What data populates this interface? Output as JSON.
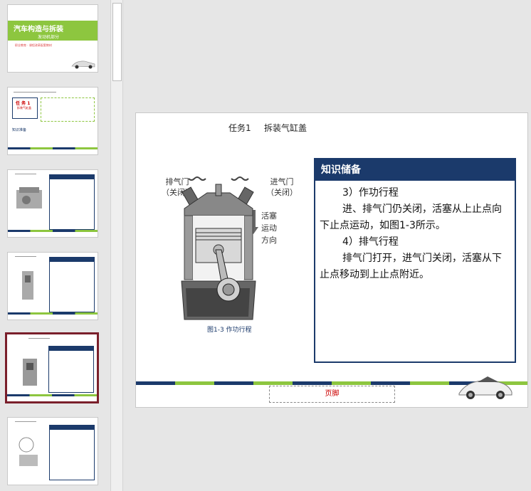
{
  "thumbnails": [
    {
      "index": 1,
      "title": "汽车构造与拆装",
      "subtitle": "发动机部分",
      "note": "职业教育 · 课程改革配套教材"
    },
    {
      "index": 2,
      "task_badge": "任 务",
      "task_num": "1",
      "sub": "知识准备",
      "caption": "拆装气缸盖"
    },
    {
      "index": 3
    },
    {
      "index": 4
    },
    {
      "index": 5,
      "selected": true
    },
    {
      "index": 6
    }
  ],
  "slide": {
    "task_no": "任务1",
    "task_title": "拆装气缸盖",
    "knowledge_box": {
      "heading": "知识储备",
      "paragraphs": [
        "3）作功行程",
        "进、排气门仍关闭，活塞从上止点向下止点运动，如图1-3所示。",
        "4）排气行程",
        "排气门打开，进气门关闭，活塞从下止点移动到上止点附近。"
      ]
    },
    "figure": {
      "exhaust_label_1": "排气门",
      "exhaust_label_2": "（关闭）",
      "intake_label_1": "进气门",
      "intake_label_2": "（关闭）",
      "piston_label": [
        "活塞",
        "运动",
        "方向"
      ],
      "caption": "图1-3  作功行程"
    },
    "footer_text": "页脚"
  },
  "colors": {
    "navy": "#1b3a6b",
    "green": "#8dc63f",
    "selected_border": "#7a1f2b"
  }
}
